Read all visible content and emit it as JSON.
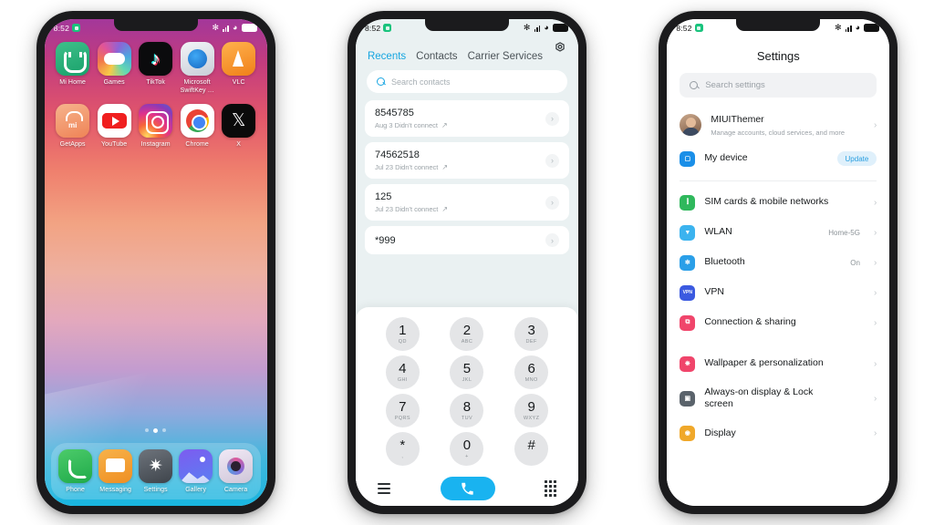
{
  "status_bar": {
    "time": "8:52",
    "icons": [
      "badge-icon",
      "bluetooth-icon",
      "signal-icon",
      "wifi-icon",
      "battery-icon"
    ]
  },
  "home_screen": {
    "apps_row1": [
      {
        "label": "Mi Home",
        "icon": "mi-home-icon"
      },
      {
        "label": "Games",
        "icon": "games-icon"
      },
      {
        "label": "TikTok",
        "icon": "tiktok-icon"
      },
      {
        "label": "Microsoft SwiftKey …",
        "icon": "swiftkey-icon"
      },
      {
        "label": "VLC",
        "icon": "vlc-icon"
      }
    ],
    "apps_row2": [
      {
        "label": "GetApps",
        "icon": "getapps-icon"
      },
      {
        "label": "YouTube",
        "icon": "youtube-icon"
      },
      {
        "label": "Instagram",
        "icon": "instagram-icon"
      },
      {
        "label": "Chrome",
        "icon": "chrome-icon"
      },
      {
        "label": "X",
        "icon": "x-icon"
      }
    ],
    "dock": [
      {
        "label": "Phone",
        "icon": "phone-icon"
      },
      {
        "label": "Messaging",
        "icon": "messaging-icon"
      },
      {
        "label": "Settings",
        "icon": "settings-icon"
      },
      {
        "label": "Gallery",
        "icon": "gallery-icon"
      },
      {
        "label": "Camera",
        "icon": "camera-icon"
      }
    ],
    "page_dots": 3,
    "active_dot": 2
  },
  "dialer": {
    "gear_icon": "gear-icon",
    "tabs": [
      {
        "label": "Recents",
        "active": true
      },
      {
        "label": "Contacts",
        "active": false
      },
      {
        "label": "Carrier Services",
        "active": false
      }
    ],
    "search": {
      "placeholder": "Search contacts",
      "icon": "search-icon"
    },
    "calls": [
      {
        "number": "8545785",
        "detail": "Aug 3 Didn't connect",
        "direction": "outgoing"
      },
      {
        "number": "74562518",
        "detail": "Jul 23 Didn't connect",
        "direction": "outgoing"
      },
      {
        "number": "125",
        "detail": "Jul 23 Didn't connect",
        "direction": "outgoing"
      },
      {
        "number": "*999",
        "detail": "",
        "direction": "outgoing"
      }
    ],
    "keypad": [
      {
        "digit": "1",
        "letters": "QD"
      },
      {
        "digit": "2",
        "letters": "ABC"
      },
      {
        "digit": "3",
        "letters": "DEF"
      },
      {
        "digit": "4",
        "letters": "GHI"
      },
      {
        "digit": "5",
        "letters": "JKL"
      },
      {
        "digit": "6",
        "letters": "MNO"
      },
      {
        "digit": "7",
        "letters": "PQRS"
      },
      {
        "digit": "8",
        "letters": "TUV"
      },
      {
        "digit": "9",
        "letters": "WXYZ"
      },
      {
        "digit": "*",
        "letters": ","
      },
      {
        "digit": "0",
        "letters": "+"
      },
      {
        "digit": "#",
        "letters": ""
      }
    ],
    "bottom_bar": {
      "menu_icon": "menu-icon",
      "call_icon": "call-icon",
      "keypad_icon": "keypad-icon",
      "call_button_color": "#19b3f0"
    }
  },
  "settings": {
    "title": "Settings",
    "search": {
      "placeholder": "Search settings",
      "icon": "search-icon"
    },
    "account": {
      "name": "MIUIThemer",
      "subtitle": "Manage accounts, cloud services, and more",
      "avatar": "avatar"
    },
    "device": {
      "label": "My device",
      "badge": "Update",
      "icon": "device-icon",
      "icon_color": "#1a8fe8"
    },
    "group_connectivity": [
      {
        "label": "SIM cards & mobile networks",
        "value": "",
        "icon": "sim-icon",
        "color": "#2fb85c"
      },
      {
        "label": "WLAN",
        "value": "Home-5G",
        "icon": "wlan-icon",
        "color": "#3bb3ef"
      },
      {
        "label": "Bluetooth",
        "value": "On",
        "icon": "bluetooth-icon",
        "color": "#2a9fe8"
      },
      {
        "label": "VPN",
        "value": "",
        "icon": "vpn-icon",
        "color": "#3b5ae0"
      },
      {
        "label": "Connection & sharing",
        "value": "",
        "icon": "connection-sharing-icon",
        "color": "#f0456b"
      }
    ],
    "group_display": [
      {
        "label": "Wallpaper & personalization",
        "value": "",
        "icon": "wallpaper-icon",
        "color": "#f0456b"
      },
      {
        "label": "Always-on display & Lock screen",
        "value": "",
        "icon": "aod-lock-icon",
        "color": "#5a636b"
      },
      {
        "label": "Display",
        "value": "",
        "icon": "display-icon",
        "color": "#f0a82a"
      }
    ]
  }
}
